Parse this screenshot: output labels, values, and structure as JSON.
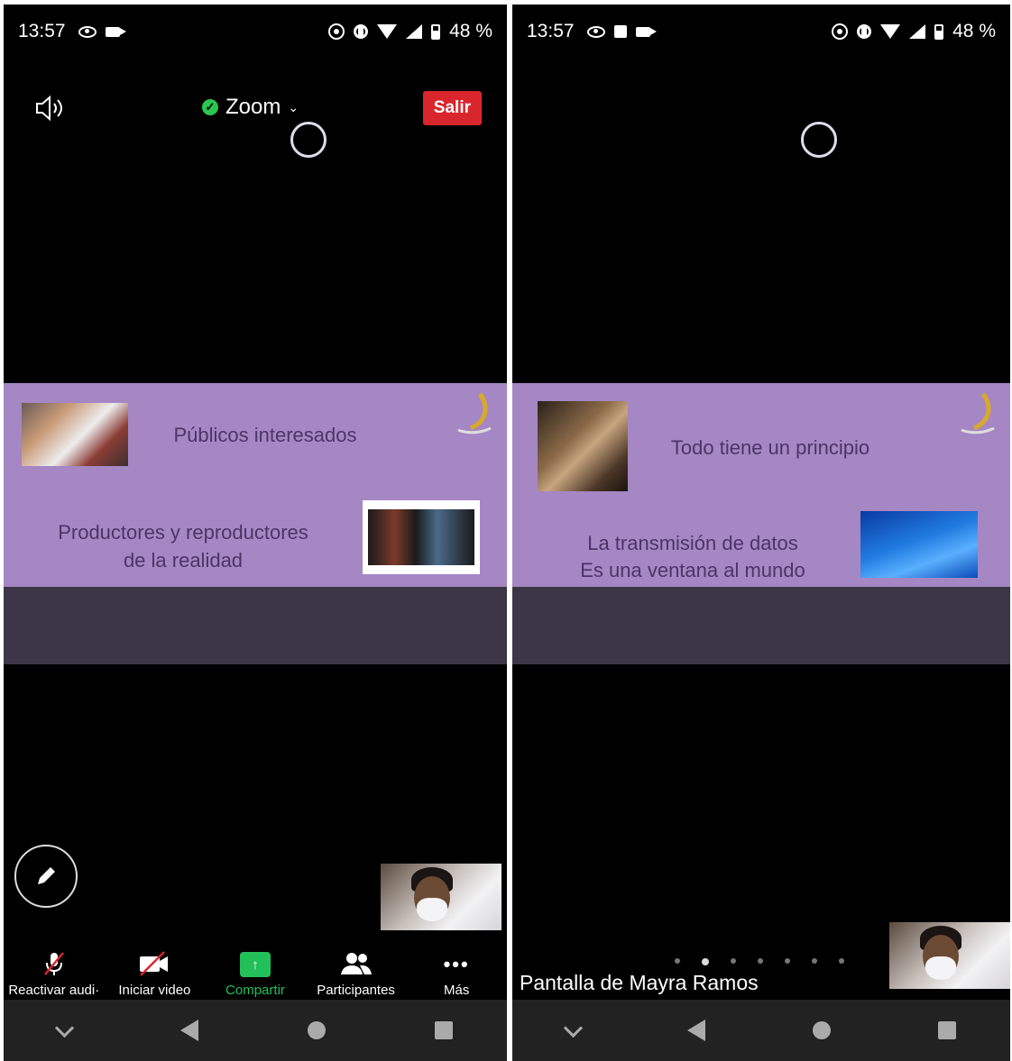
{
  "left_screen": {
    "status": {
      "time": "13:57",
      "battery": "48 %"
    },
    "header": {
      "title": "Zoom",
      "exit_label": "Salir"
    },
    "slide": {
      "line1": "Públicos interesados",
      "line2a": "Productores y reproductores",
      "line2b": "de la realidad"
    },
    "toolbar": [
      {
        "label": "Reactivar audi·",
        "icon": "mic-muted-icon"
      },
      {
        "label": "Iniciar video",
        "icon": "video-off-icon"
      },
      {
        "label": "Compartir",
        "icon": "share-icon"
      },
      {
        "label": "Participantes",
        "icon": "participants-icon"
      },
      {
        "label": "Más",
        "icon": "more-icon"
      }
    ]
  },
  "right_screen": {
    "status": {
      "time": "13:57",
      "battery": "48 %"
    },
    "slide": {
      "line1": "Todo tiene un principio",
      "line2a": "La transmisión de datos",
      "line2b": "Es una ventana al mundo"
    },
    "screen_share_name": "Pantalla de Mayra Ramos",
    "pager": {
      "count": 7,
      "active_index": 1
    }
  },
  "colors": {
    "slide_purple": "#a587c4",
    "exit_red": "#d9262c",
    "share_green": "#23c05a",
    "shield_green": "#2ac650"
  }
}
